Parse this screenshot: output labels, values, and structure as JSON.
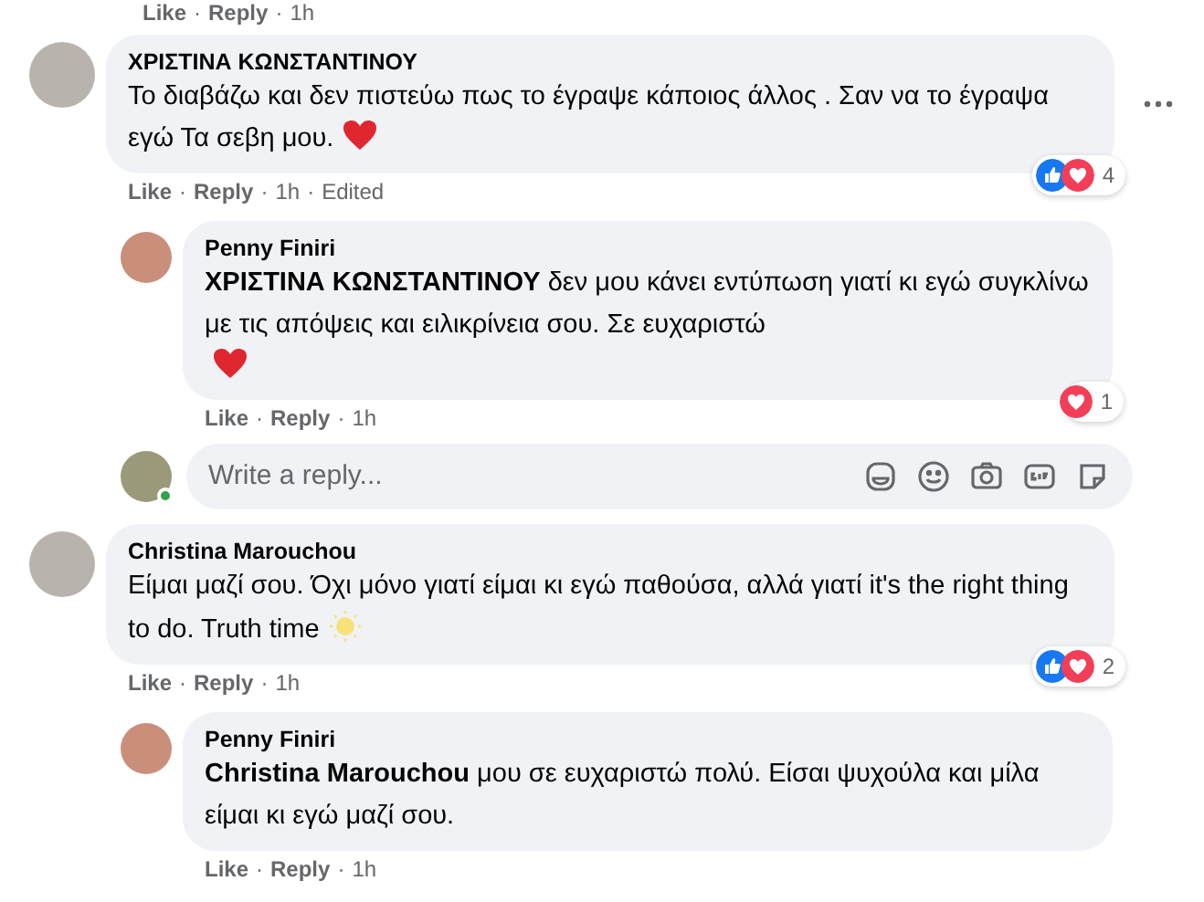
{
  "top_actions": {
    "like": "Like",
    "reply": "Reply",
    "time": "1h",
    "separator": "·"
  },
  "threads": [
    {
      "comment": {
        "author": "ΧΡΙΣΤΙΝΑ ΚΩΝΣΤΑΝΤΙΝΟΥ",
        "text": "Το διαβάζω και δεν πιστεύω πως το έγραψε κάποιος άλλος . Σαν να το έγραψα εγώ Τα σεβη μου.",
        "emoji": {
          "kind": "heart"
        },
        "menu_visible": true,
        "reactions": [
          {
            "kind": "like"
          },
          {
            "kind": "love"
          }
        ],
        "reaction_count": "4",
        "actions": {
          "like": "Like",
          "reply": "Reply",
          "time": "1h",
          "edited": "Edited",
          "separator": "·"
        }
      },
      "replies": [
        {
          "author": "Penny Finiri",
          "text": "**ΧΡΙΣΤΙΝΑ ΚΩΝΣΤΑΝΤΙΝΟΥ** δεν μου κάνει εντύπωση γιατί κι εγώ συγκλίνω με τις απόψεις και ειλικρίνεια σου. Σε ευχαριστώ",
          "emoji": {
            "kind": "heart",
            "new_line": true
          },
          "reactions": [
            {
              "kind": "love"
            }
          ],
          "reaction_count": "1",
          "actions": {
            "like": "Like",
            "reply": "Reply",
            "time": "1h",
            "separator": "·"
          }
        }
      ],
      "reply_box": {
        "placeholder": "Write a reply...",
        "online": true
      }
    },
    {
      "comment": {
        "author": "Christina Marouchou",
        "text": "Είμαι μαζί σου. Όχι μόνο γιατί είμαι κι εγώ παθούσα, αλλά γιατί it's the right thing to do. Truth time",
        "emoji": {
          "kind": "sun"
        },
        "menu_visible": false,
        "reactions": [
          {
            "kind": "like"
          },
          {
            "kind": "love"
          }
        ],
        "reaction_count": "2",
        "actions": {
          "like": "Like",
          "reply": "Reply",
          "time": "1h",
          "separator": "·"
        }
      },
      "replies": [
        {
          "author": "Penny Finiri",
          "text": "**Christina Marouchou** μου σε ευχαριστώ πολύ. Είσαι ψυχούλα και μίλα είμαι κι εγώ μαζί σου.",
          "actions": {
            "like": "Like",
            "reply": "Reply",
            "time": "1h",
            "separator": "·"
          }
        }
      ]
    }
  ]
}
